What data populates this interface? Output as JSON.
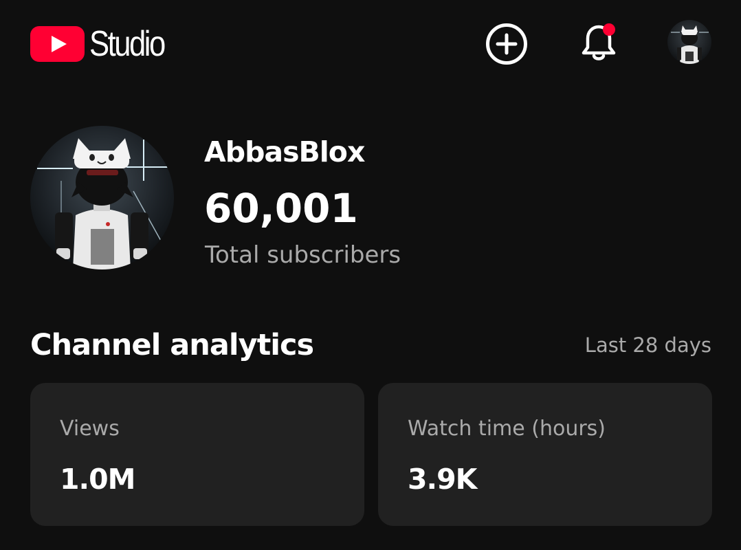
{
  "app": {
    "logo_text": "Studio"
  },
  "icons": {
    "logo": "youtube-play-icon",
    "create": "plus-circle-icon",
    "notifications": "bell-icon",
    "account": "avatar"
  },
  "colors": {
    "background": "#0f0f0f",
    "card_background": "#212121",
    "accent_red": "#ff0033",
    "secondary_text": "#aaaaaa",
    "primary_text": "#ffffff"
  },
  "notifications": {
    "has_unread": true
  },
  "channel": {
    "name": "AbbasBlox",
    "subscriber_count": "60,001",
    "subscriber_label": "Total subscribers"
  },
  "analytics": {
    "title": "Channel analytics",
    "period": "Last 28 days",
    "cards": [
      {
        "label": "Views",
        "value": "1.0M"
      },
      {
        "label": "Watch time (hours)",
        "value": "3.9K"
      }
    ]
  }
}
